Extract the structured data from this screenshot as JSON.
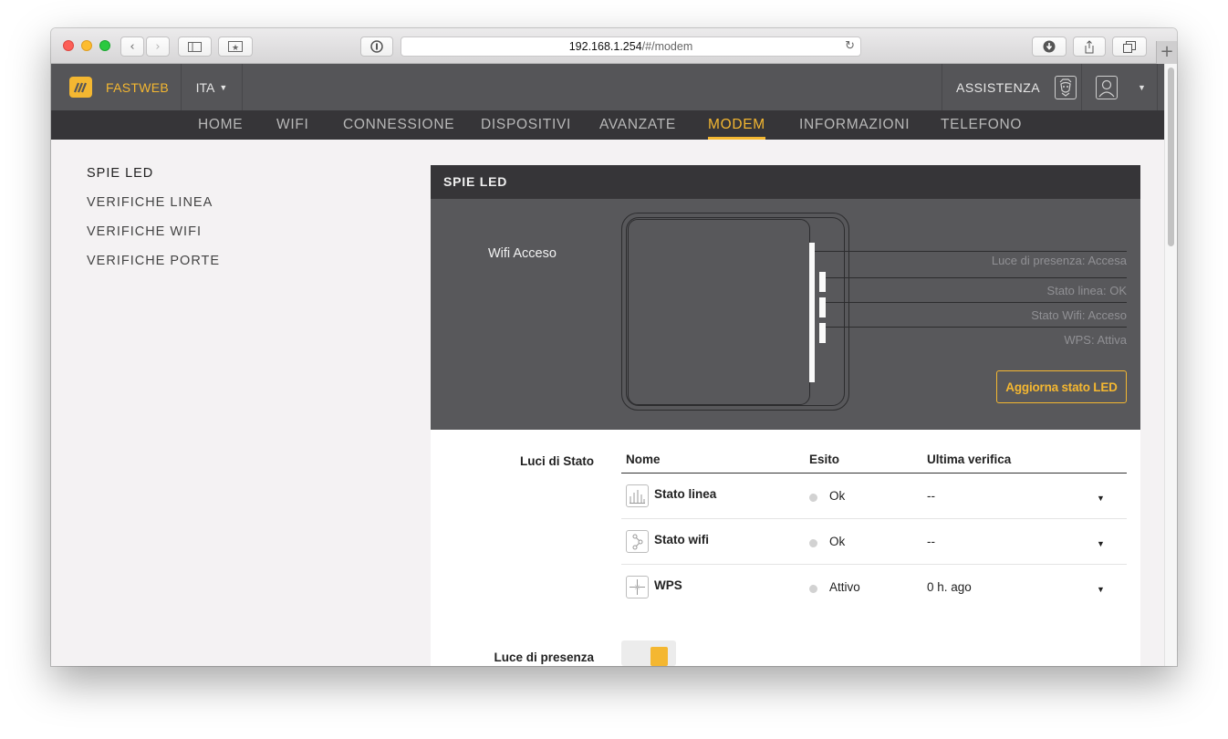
{
  "browser": {
    "url_host": "192.168.1.254",
    "url_path": "/#/modem",
    "icons": [
      "back-icon",
      "forward-icon",
      "sidebar-icon",
      "bookmarks-icon",
      "reader-icon",
      "reload-icon",
      "download-icon",
      "share-icon",
      "tabs-icon",
      "new-tab-icon"
    ]
  },
  "header": {
    "brand": "FASTWEB",
    "language": "ITA",
    "assist_label": "ASSISTENZA"
  },
  "nav": {
    "items": [
      "HOME",
      "WIFI",
      "CONNESSIONE",
      "DISPOSITIVI",
      "AVANZATE",
      "MODEM",
      "INFORMAZIONI",
      "TELEFONO"
    ],
    "active": "MODEM"
  },
  "sidebar": {
    "items": [
      "SPIE LED",
      "VERIFICHE LINEA",
      "VERIFICHE WIFI",
      "VERIFICHE PORTE"
    ],
    "active": "SPIE LED"
  },
  "panel": {
    "title": "SPIE LED",
    "wifi_status": "Wifi Acceso",
    "led_labels": [
      "Luce di presenza: Accesa",
      "Stato linea: OK",
      "Stato Wifi: Acceso",
      "WPS: Attiva"
    ],
    "refresh_button": "Aggiorna stato LED",
    "status_section_label": "Luci di Stato",
    "columns": [
      "Nome",
      "Esito",
      "Ultima verifica"
    ],
    "rows": [
      {
        "icon": "line-chart-icon",
        "name": "Stato linea",
        "esito": "Ok",
        "last": "--"
      },
      {
        "icon": "wifi-branch-icon",
        "name": "Stato wifi",
        "esito": "Ok",
        "last": "--"
      },
      {
        "icon": "wps-icon",
        "name": "WPS",
        "esito": "Attivo",
        "last": "0 h. ago"
      }
    ],
    "presence_label": "Luce di presenza",
    "presence_on": true
  },
  "colors": {
    "accent": "#f4b731",
    "header_bg": "#555558",
    "nav_bg": "#363538",
    "panel_dark": "#58585b"
  }
}
